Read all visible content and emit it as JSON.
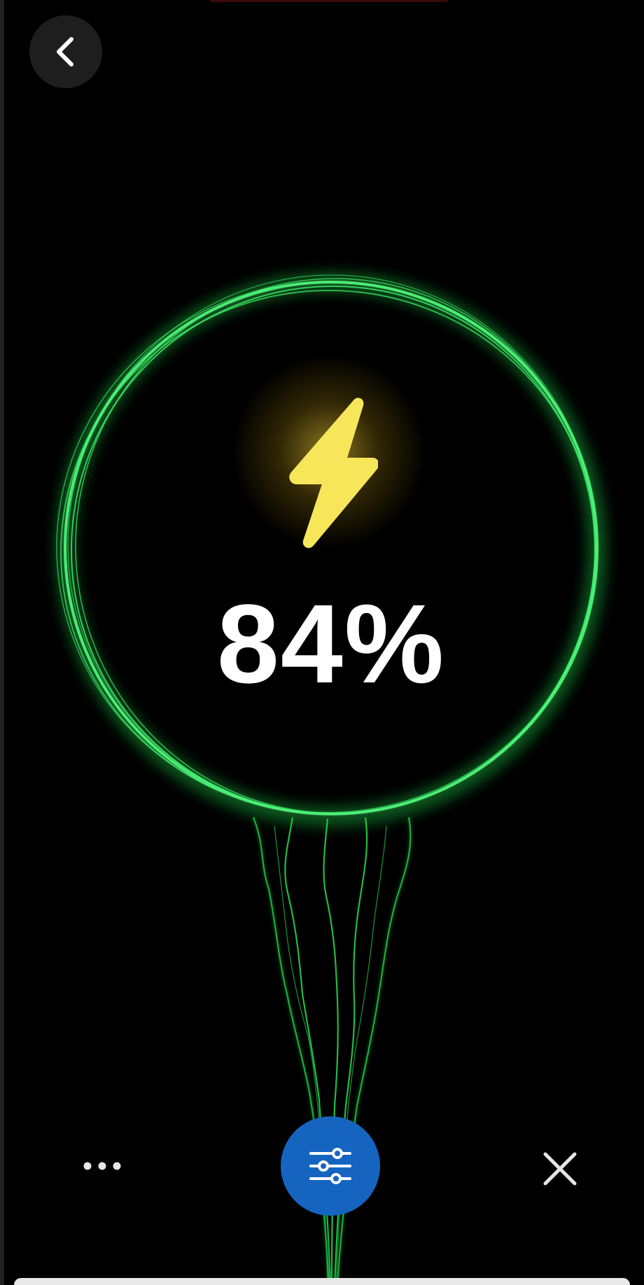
{
  "battery": {
    "level_text": "84%",
    "level_percent": 84,
    "charging": true
  },
  "icons": {
    "back": "chevron-left-icon",
    "charge": "lightning-bolt-icon",
    "more": "more-dots-icon",
    "settings": "sliders-icon",
    "close": "close-icon"
  },
  "colors": {
    "background": "#000000",
    "ring": "#2ee85a",
    "bolt": "#f7e65a",
    "settings_button": "#1565c0",
    "text": "#ffffff"
  }
}
